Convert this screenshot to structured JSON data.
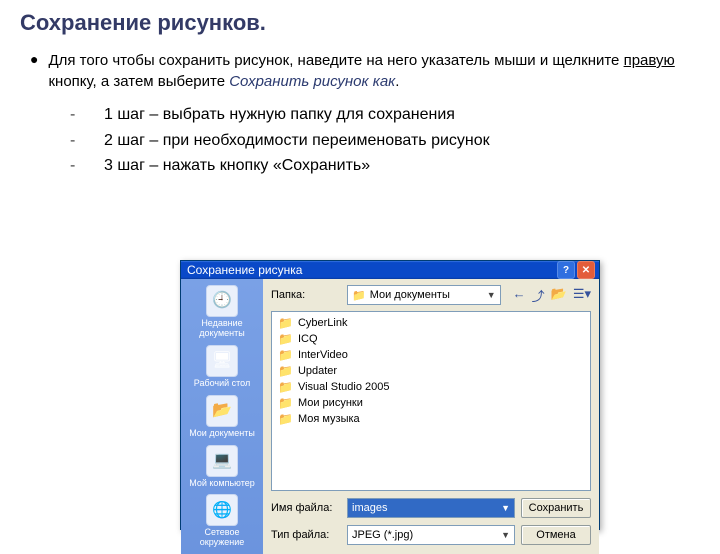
{
  "slide": {
    "title": "Сохранение рисунков.",
    "para_pre": "Для того чтобы сохранить рисунок, наведите на него указатель мыши и щелкните ",
    "para_underlined": "правую",
    "para_mid": " кнопку, а затем выберите ",
    "para_italic": "Сохранить рисунок как",
    "para_end": ".",
    "steps": [
      "1 шаг – выбрать нужную папку для сохранения",
      "2 шаг – при необходимости переименовать рисунок",
      "3 шаг – нажать кнопку «Сохранить»"
    ]
  },
  "dialog": {
    "title": "Сохранение рисунка",
    "folder_label": "Папка:",
    "folder_selected": "Мои документы",
    "places": [
      {
        "label": "Недавние документы",
        "glyph": "🕘"
      },
      {
        "label": "Рабочий стол",
        "glyph": "🖥"
      },
      {
        "label": "Мои документы",
        "glyph": "📂"
      },
      {
        "label": "Мой компьютер",
        "glyph": "💻"
      },
      {
        "label": "Сетевое окружение",
        "glyph": "🌐"
      }
    ],
    "files": [
      "CyberLink",
      "ICQ",
      "InterVideo",
      "Updater",
      "Visual Studio 2005",
      "Мои рисунки",
      "Моя музыка"
    ],
    "filename_label": "Имя файла:",
    "filename_value": "images",
    "filetype_label": "Тип файла:",
    "filetype_value": "JPEG (*.jpg)",
    "save_label": "Сохранить",
    "cancel_label": "Отмена"
  }
}
